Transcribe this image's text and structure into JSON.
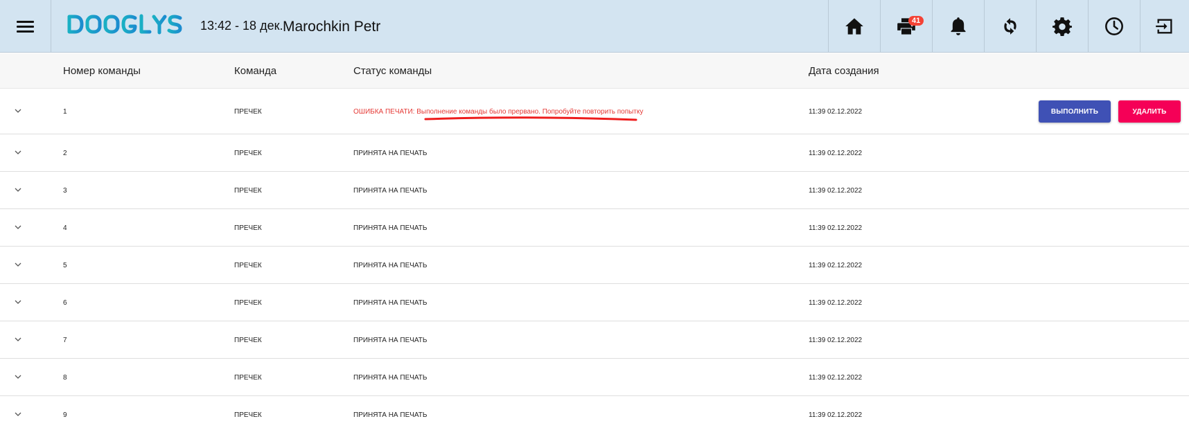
{
  "header": {
    "logo_text": "DOOGLYS",
    "clock": "13:42 - 18 дек.",
    "user": "Marochkin Petr",
    "print_queue_badge": "41",
    "icons": [
      "home-icon",
      "print-queue-icon",
      "bell-icon",
      "sync-icon",
      "gear-icon",
      "clock-icon",
      "logout-icon"
    ]
  },
  "table": {
    "columns": {
      "number": "Номер команды",
      "command": "Команда",
      "status": "Статус команды",
      "created": "Дата создания"
    },
    "rows": [
      {
        "num": "1",
        "command": "ПРЕЧЕК",
        "status_prefix": "ОШИБКА ПЕЧАТИ: ",
        "status": "Выполнение команды было прервано. Попробуйте повторить попытку",
        "date": "11:39 02.12.2022",
        "execute": "ВЫПОЛНИТЬ",
        "delete": "УДАЛИТЬ"
      },
      {
        "num": "2",
        "command": "ПРЕЧЕК",
        "status": "ПРИНЯТА НА ПЕЧАТЬ",
        "date": "11:39 02.12.2022"
      },
      {
        "num": "3",
        "command": "ПРЕЧЕК",
        "status": "ПРИНЯТА НА ПЕЧАТЬ",
        "date": "11:39 02.12.2022"
      },
      {
        "num": "4",
        "command": "ПРЕЧЕК",
        "status": "ПРИНЯТА НА ПЕЧАТЬ",
        "date": "11:39 02.12.2022"
      },
      {
        "num": "5",
        "command": "ПРЕЧЕК",
        "status": "ПРИНЯТА НА ПЕЧАТЬ",
        "date": "11:39 02.12.2022"
      },
      {
        "num": "6",
        "command": "ПРЕЧЕК",
        "status": "ПРИНЯТА НА ПЕЧАТЬ",
        "date": "11:39 02.12.2022"
      },
      {
        "num": "7",
        "command": "ПРЕЧЕК",
        "status": "ПРИНЯТА НА ПЕЧАТЬ",
        "date": "11:39 02.12.2022"
      },
      {
        "num": "8",
        "command": "ПРЕЧЕК",
        "status": "ПРИНЯТА НА ПЕЧАТЬ",
        "date": "11:39 02.12.2022"
      },
      {
        "num": "9",
        "command": "ПРЕЧЕК",
        "status": "ПРИНЯТА НА ПЕЧАТЬ",
        "date": "11:39 02.12.2022"
      }
    ]
  },
  "colors": {
    "header_bg": "#d3e4f1",
    "logo": "#1ea0c8",
    "error": "#e53935",
    "execute_button": "#3f51b5",
    "delete_button": "#f50057",
    "badge": "#f44336"
  }
}
